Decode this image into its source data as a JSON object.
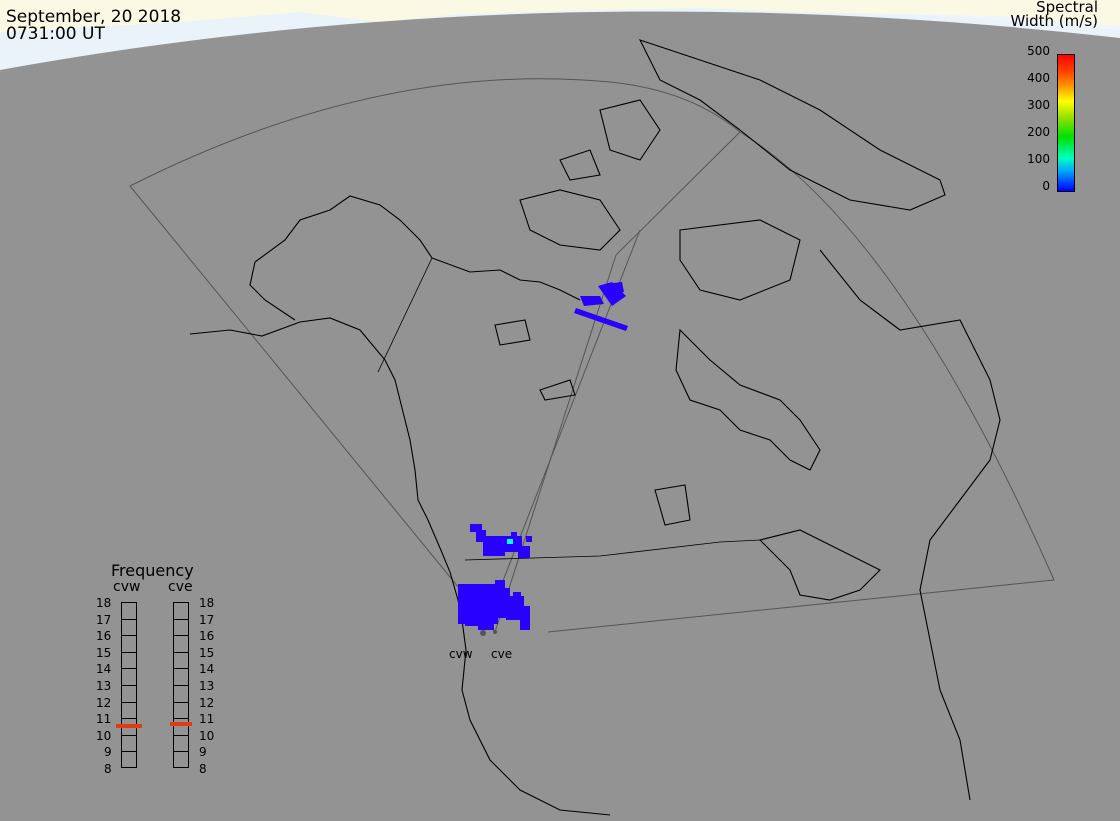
{
  "header": {
    "date": "September, 20 2018",
    "time": "0731:00 UT"
  },
  "colorbar": {
    "title_line1": "Spectral",
    "title_line2": "Width (m/s)",
    "ticks": [
      "500",
      "400",
      "300",
      "200",
      "100",
      "0"
    ],
    "range": [
      0,
      500
    ],
    "colors": [
      "#0000ff",
      "#00a0ff",
      "#00ffc0",
      "#00e000",
      "#a0e000",
      "#ffff00",
      "#ffa000",
      "#ff4000",
      "#ff0000"
    ]
  },
  "frequency": {
    "title": "Frequency",
    "radars": [
      "cvw",
      "cve"
    ],
    "scale": [
      "18",
      "17",
      "16",
      "15",
      "14",
      "13",
      "12",
      "11",
      "10",
      "9",
      "8"
    ],
    "unit_range": [
      8,
      18
    ],
    "cvw_value": 10.6,
    "cve_value": 10.7
  },
  "sites": {
    "west": "cvw",
    "east": "cve"
  },
  "colors": {
    "background": "#939393",
    "ice": "#fefee6",
    "scatter": "#2800ff",
    "scatter_hot": "#00ffff"
  }
}
